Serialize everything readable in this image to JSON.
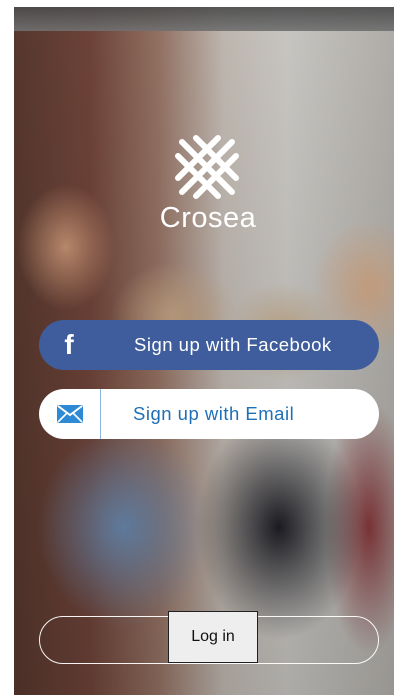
{
  "app": {
    "name": "Crosea"
  },
  "signup": {
    "facebook": {
      "label": "Sign up with Facebook",
      "icon": "facebook-icon",
      "color": "#3f5d9c"
    },
    "email": {
      "label": "Sign up with Email",
      "icon": "mail-icon",
      "color": "#1f6fb6"
    }
  },
  "login": {
    "label": "Log in"
  }
}
